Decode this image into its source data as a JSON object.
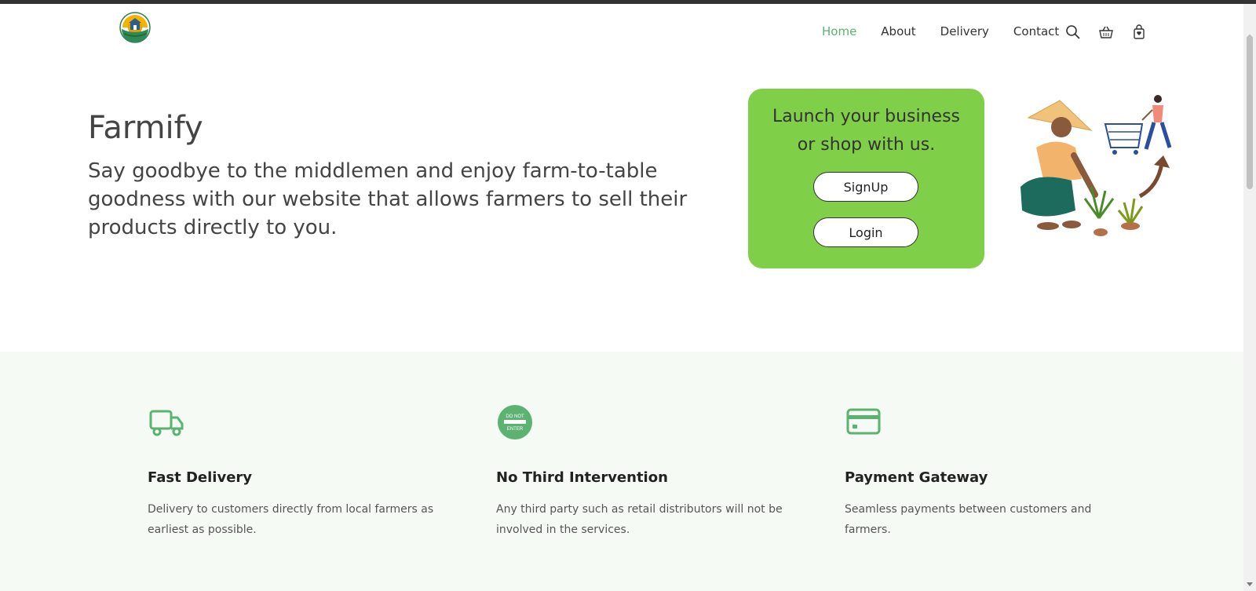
{
  "nav": {
    "items": [
      {
        "label": "Home",
        "active": true
      },
      {
        "label": "About",
        "active": false
      },
      {
        "label": "Delivery",
        "active": false
      },
      {
        "label": "Contact",
        "active": false
      }
    ],
    "icons": [
      "search-icon",
      "basket-icon",
      "shopping-bag-icon"
    ]
  },
  "hero": {
    "title": "Farmify",
    "subtitle": "Say goodbye to the middlemen and enjoy farm-to-table goodness with our website that allows farmers to sell their products directly to you."
  },
  "cta": {
    "text": "Launch your business or shop with us.",
    "signup_label": "SignUp",
    "login_label": "Login"
  },
  "features": [
    {
      "icon": "truck-icon",
      "title": "Fast Delivery",
      "description": "Delivery to customers directly from local farmers as earliest as possible."
    },
    {
      "icon": "do-not-enter-icon",
      "icon_text_1": "DO NOT",
      "icon_text_2": "ENTER",
      "title": "No Third Intervention",
      "description": "Any third party such as retail distributors will not be involved in the services."
    },
    {
      "icon": "credit-card-icon",
      "title": "Payment Gateway",
      "description": "Seamless payments between customers and farmers."
    }
  ],
  "colors": {
    "accent": "#5cb270",
    "cta_background": "#80cf48",
    "features_background": "#f6faf5"
  }
}
